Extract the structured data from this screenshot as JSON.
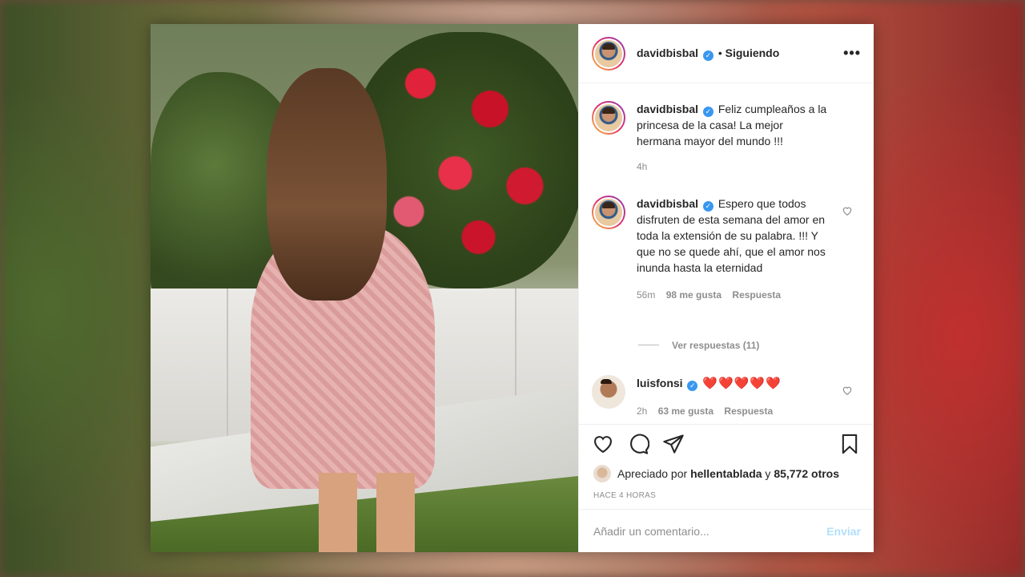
{
  "post": {
    "author": "davidbisbal",
    "follow_status": "Siguiendo",
    "more_icon": "more-options-icon",
    "caption": {
      "username": "davidbisbal",
      "text": "Feliz cumpleaños a la princesa de la casa! La mejor hermana mayor del mundo !!!",
      "time": "4h"
    },
    "comments": [
      {
        "username": "davidbisbal",
        "text": "Espero que todos disfruten de esta semana del amor en toda la extensión de su palabra. !!! Y que no se quede ahí, que el amor nos inunda hasta la eternidad",
        "time": "56m",
        "likes": "98 me gusta",
        "reply": "Respuesta",
        "view_replies": "Ver respuestas (11)"
      },
      {
        "username": "luisfonsi",
        "text": "❤️❤️❤️❤️❤️",
        "time": "2h",
        "likes": "63 me gusta",
        "reply": "Respuesta"
      }
    ],
    "liked_by_prefix": "Apreciado por",
    "liked_by_user": "hellentablada",
    "liked_by_suffix_pre": "y",
    "liked_by_others": "85,772 otros",
    "posted_ago": "HACE 4 HORAS",
    "comment_placeholder": "Añadir un comentario...",
    "send_label": "Enviar"
  },
  "colors": {
    "verified": "#3897f0",
    "link_disabled": "#b2dffc",
    "heart": "#ed1c24"
  }
}
